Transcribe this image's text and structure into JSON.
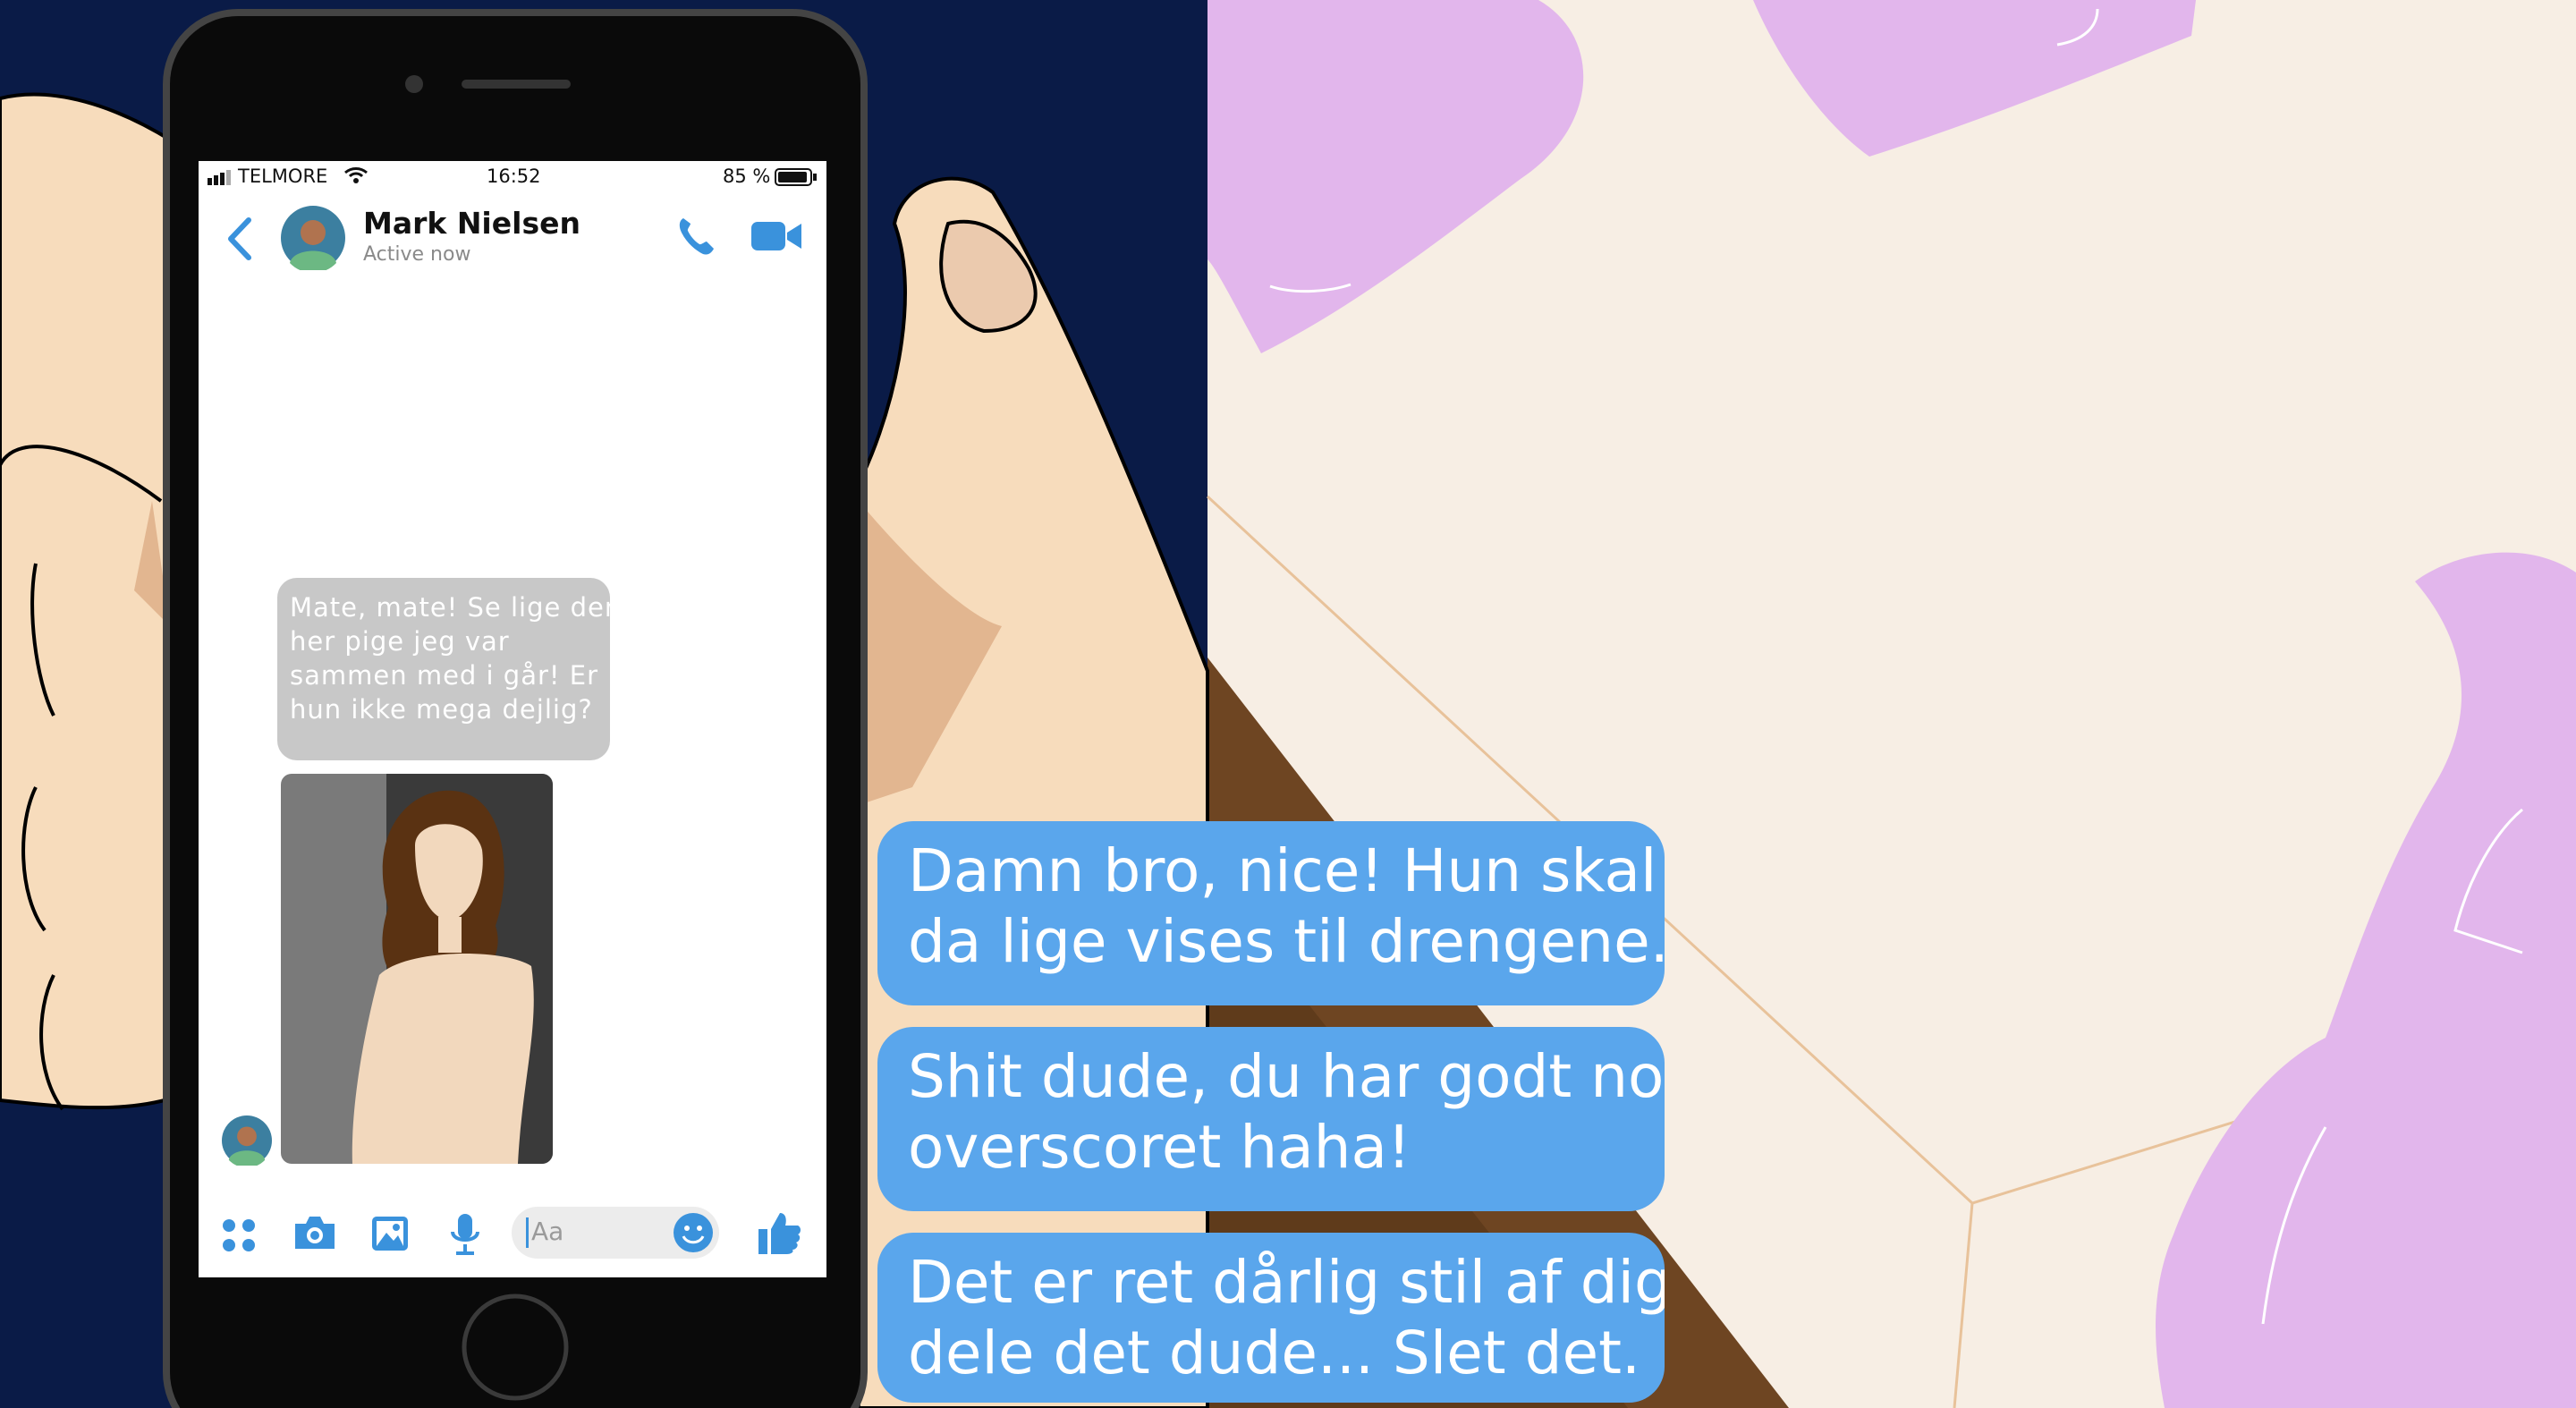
{
  "status_bar": {
    "carrier": "TELMORE",
    "time": "16:52",
    "battery": "85 %"
  },
  "header": {
    "contact_name": "Mark Nielsen",
    "presence": "Active now"
  },
  "incoming_message": {
    "lines": [
      "Mate, mate! Se lige den",
      "her pige jeg var",
      "sammen med i går! Er",
      "hun ikke mega dejlig?"
    ]
  },
  "composer": {
    "placeholder": "Aa"
  },
  "reply_options": [
    {
      "lines": [
        "Damn bro, nice! Hun skal",
        "da lige vises til drengene."
      ]
    },
    {
      "lines": [
        "Shit dude, du har godt nok",
        "overscoret haha!"
      ]
    },
    {
      "lines": [
        "Det er ret dårlig stil af dig at",
        "dele det dude... Slet det."
      ]
    }
  ],
  "colors": {
    "night_bg": "#0a1b47",
    "wall": "#f7eee4",
    "pillow": "#e2b6ec",
    "floor": "#6e4522",
    "skin": "#f7dcbc",
    "skin_shadow": "#e2b690",
    "accent_blue": "#3a92dc",
    "reply_bubble": "#5aa6ec",
    "incoming_bubble": "#c8c8c8"
  },
  "icons": [
    "back-chevron-icon",
    "phone-icon",
    "video-camera-icon",
    "apps-grid-icon",
    "camera-icon",
    "image-icon",
    "microphone-icon",
    "emoji-icon",
    "thumbs-up-icon",
    "wifi-icon",
    "signal-icon",
    "battery-icon"
  ]
}
